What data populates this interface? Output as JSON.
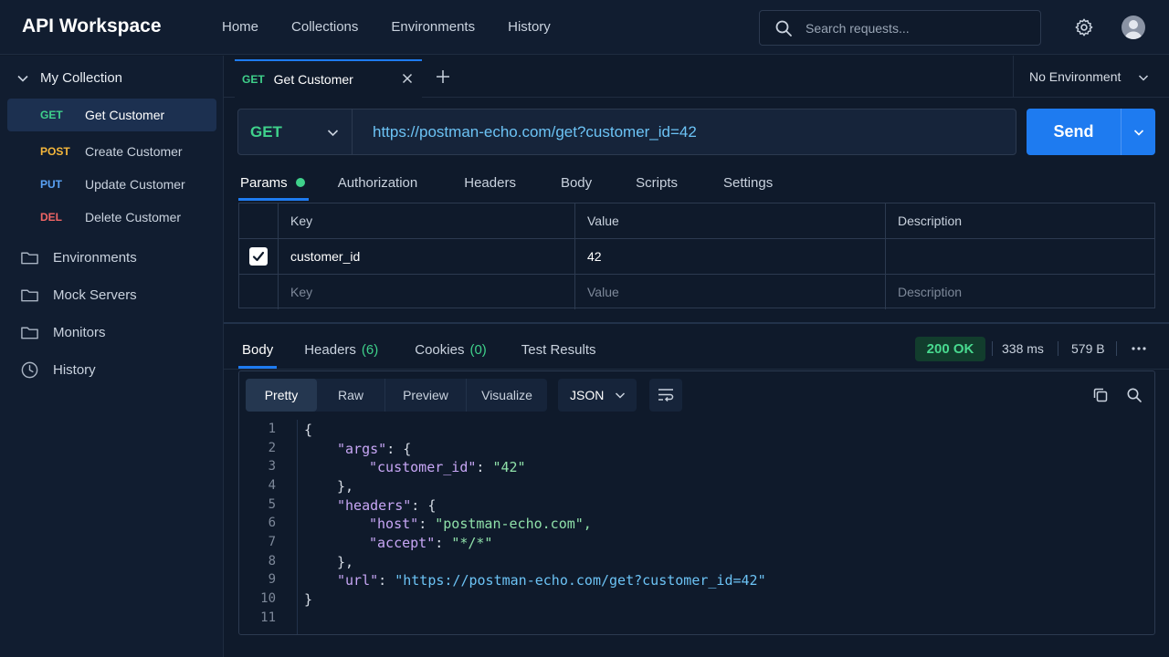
{
  "app": {
    "title": "API Workspace"
  },
  "nav": [
    "Home",
    "Collections",
    "Environments",
    "History"
  ],
  "search": {
    "placeholder": "Search requests..."
  },
  "sidebar": {
    "collection": "My Collection",
    "requests": [
      {
        "method": "GET",
        "name": "Get Customer",
        "color": "#3fd18b",
        "active": true
      },
      {
        "method": "POST",
        "name": "Create Customer",
        "color": "#f5b73b",
        "active": false
      },
      {
        "method": "PUT",
        "name": "Update Customer",
        "color": "#5aa2f5",
        "active": false
      },
      {
        "method": "DEL",
        "name": "Delete Customer",
        "color": "#f06565",
        "active": false
      }
    ],
    "sections": [
      "Environments",
      "Mock Servers",
      "Monitors",
      "History"
    ]
  },
  "request_tab": {
    "method": "GET",
    "name": "Get Customer"
  },
  "environment": "No Environment",
  "request": {
    "method": "GET",
    "url": "https://postman-echo.com/get?customer_id=42",
    "send_label": "Send"
  },
  "request_tabs": [
    "Params",
    "Authorization",
    "Headers",
    "Body",
    "Scripts",
    "Settings"
  ],
  "params": {
    "headers": [
      "Key",
      "Value",
      "Description"
    ],
    "rows": [
      {
        "key": "customer_id",
        "value": "42",
        "description": ""
      }
    ],
    "placeholders": [
      "Key",
      "Value",
      "Description"
    ]
  },
  "response": {
    "tabs": {
      "body": "Body",
      "headers": "Headers",
      "headers_count": "(6)",
      "cookies": "Cookies",
      "cookies_count": "(0)",
      "tests": "Test Results"
    },
    "status": "200 OK",
    "time": "338 ms",
    "size": "579 B",
    "formats": [
      "Pretty",
      "Raw",
      "Preview",
      "Visualize"
    ],
    "language": "JSON",
    "line_numbers": [
      "1",
      "2",
      "3",
      "4",
      "5",
      "6",
      "7",
      "8",
      "9",
      "10",
      "11"
    ],
    "code": {
      "open": "{",
      "args_key": "\"args\"",
      "args_open": ": {",
      "cid_key": "\"customer_id\"",
      "cid_sep": ": ",
      "cid_val": "\"42\"",
      "args_close": "},",
      "headers_key": "\"headers\"",
      "headers_open": ": {",
      "host_key": "\"host\"",
      "host_sep": ": ",
      "host_val": "\"postman-echo.com\",",
      "accept_key": "\"accept\"",
      "accept_sep": ": ",
      "accept_val": "\"*/*\"",
      "headers_close": "},",
      "url_key": "\"url\"",
      "url_sep": ": ",
      "url_val": "\"https://postman-echo.com/get?customer_id=42\"",
      "close": "}"
    }
  }
}
